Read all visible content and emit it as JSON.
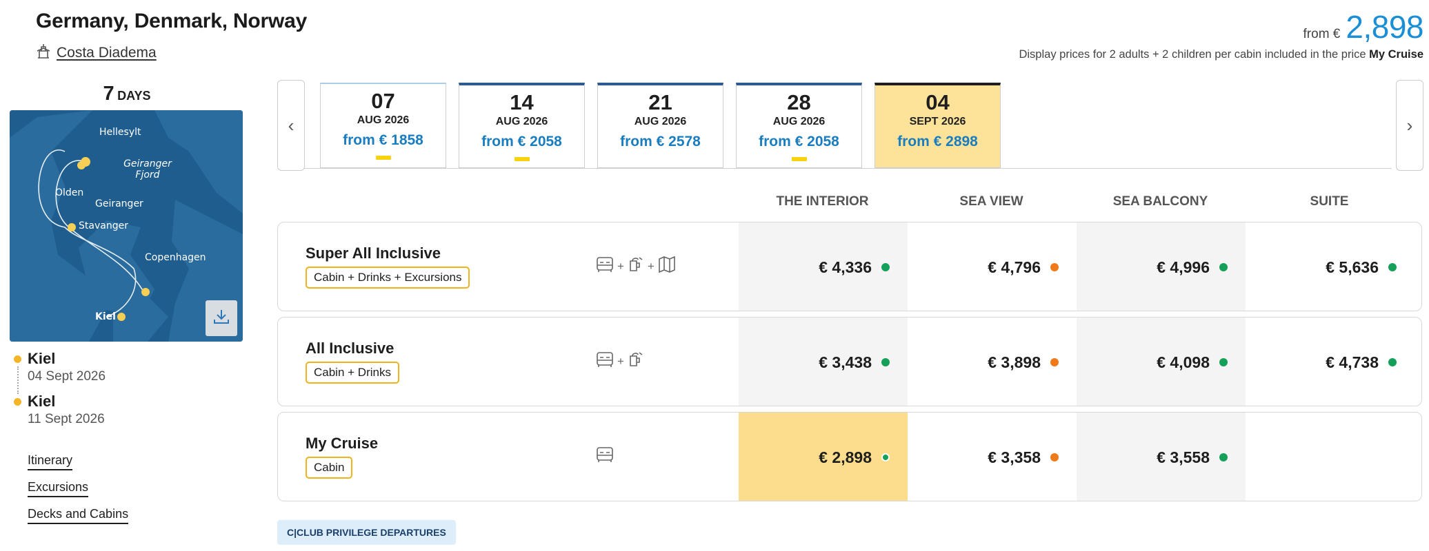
{
  "header": {
    "title": "Germany, Denmark, Norway",
    "ship": "Costa Diadema",
    "price_from_label": "from €",
    "price_from_value": "2,898",
    "note_prefix": "Display prices for 2 adults + 2 children per cabin included in the price",
    "note_bold": "My Cruise"
  },
  "sidebar": {
    "days_number": "7",
    "days_label": "DAYS",
    "map_cities": [
      "Hellesylt",
      "Geiranger Fjord",
      "Olden",
      "Geiranger",
      "Stavanger",
      "Copenhagen",
      "Kiel"
    ],
    "departure": {
      "city": "Kiel",
      "date": "04 Sept 2026"
    },
    "arrival": {
      "city": "Kiel",
      "date": "11 Sept 2026"
    },
    "links": [
      "Itinerary",
      "Excursions",
      "Decks and Cabins"
    ]
  },
  "dates": [
    {
      "day": "07",
      "month": "AUG 2026",
      "price": "from € 1858",
      "marker": true
    },
    {
      "day": "14",
      "month": "AUG 2026",
      "price": "from € 2058",
      "marker": true
    },
    {
      "day": "21",
      "month": "AUG 2026",
      "price": "from € 2578",
      "marker": false
    },
    {
      "day": "28",
      "month": "AUG 2026",
      "price": "from € 2058",
      "marker": true
    },
    {
      "day": "04",
      "month": "SEPT 2026",
      "price": "from € 2898",
      "marker": false,
      "selected": true
    }
  ],
  "columns": [
    "THE INTERIOR",
    "SEA VIEW",
    "SEA BALCONY",
    "SUITE"
  ],
  "packages": [
    {
      "name": "Super All Inclusive",
      "tag": "Cabin + Drinks + Excursions",
      "prices": [
        "€ 4,336",
        "€ 4,796",
        "€ 4,996",
        "€ 5,636"
      ]
    },
    {
      "name": "All Inclusive",
      "tag": "Cabin + Drinks",
      "prices": [
        "€ 3,438",
        "€ 3,898",
        "€ 4,098",
        "€ 4,738"
      ]
    },
    {
      "name": "My Cruise",
      "tag": "Cabin",
      "prices": [
        "€ 2,898",
        "€ 3,358",
        "€ 3,558",
        ""
      ]
    }
  ],
  "availability_colors": {
    "available": "#15a05a",
    "limited": "#f07a1a"
  },
  "accent": {
    "blue": "#1a8fd6",
    "yellow": "#fcdc8d",
    "tag_border": "#f0b31e"
  },
  "club_badge": "C|CLUB PRIVILEGE DEPARTURES",
  "icons": {
    "prev": "chevron-left-icon",
    "next": "chevron-right-icon",
    "download": "download-icon",
    "ship": "ship-icon"
  }
}
